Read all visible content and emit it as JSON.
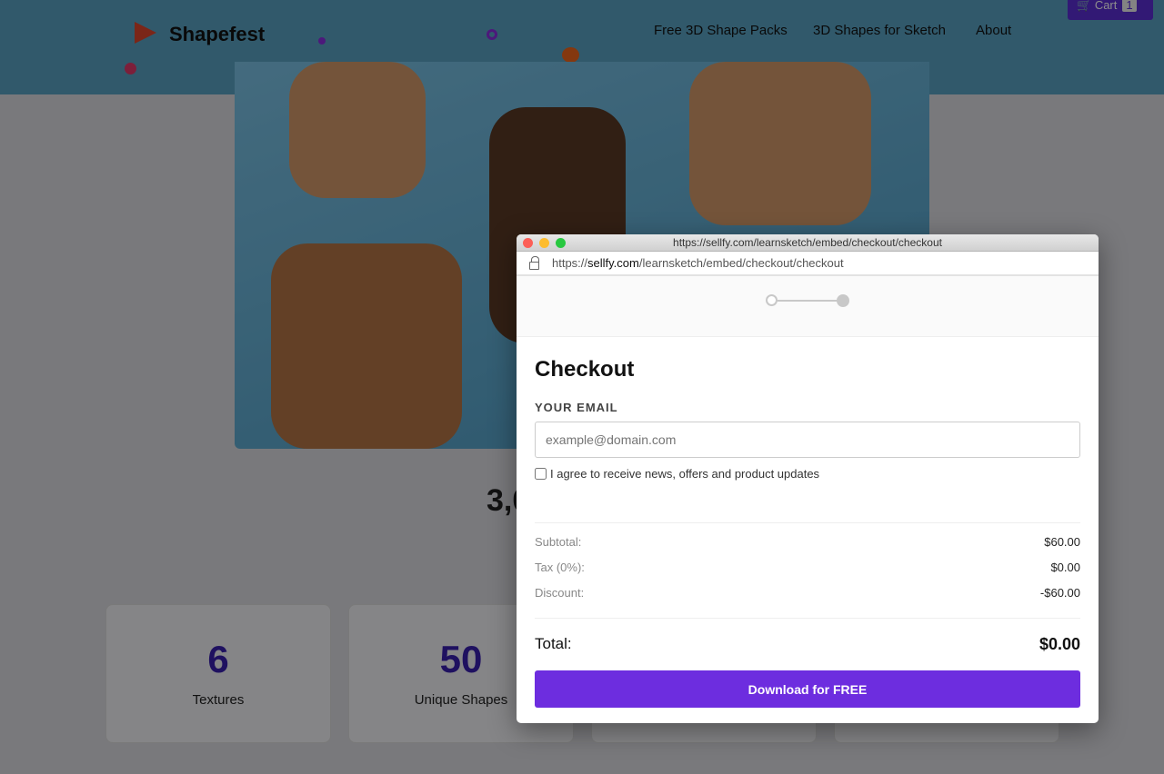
{
  "site": {
    "logo": "Shapefest",
    "nav": [
      "Free 3D Shape Packs",
      "3D Shapes for Sketch",
      "About"
    ],
    "cart_label": "Cart",
    "cart_count": "1"
  },
  "hero": {
    "headline_partial": "3,0"
  },
  "stats": [
    {
      "value": "6",
      "label": "Textures"
    },
    {
      "value": "50",
      "label": "Unique Shapes"
    },
    {
      "value": "",
      "label": ""
    },
    {
      "value": "",
      "label": ""
    }
  ],
  "popup": {
    "window_title": "https://sellfy.com/learnsketch/embed/checkout/checkout",
    "url_prefix": "https://",
    "url_domain": "sellfy.com",
    "url_path": "/learnsketch/embed/checkout/checkout",
    "steps_total": 2,
    "step_current": 1,
    "title": "Checkout",
    "email_label": "YOUR EMAIL",
    "email_placeholder": "example@domain.com",
    "email_value": "",
    "agree_label": "I agree to receive news, offers and product updates",
    "agree_checked": false,
    "summary": [
      {
        "k": "Subtotal:",
        "v": "$60.00"
      },
      {
        "k": "Tax (0%):",
        "v": "$0.00"
      },
      {
        "k": "Discount:",
        "v": "-$60.00"
      }
    ],
    "total_label": "Total:",
    "total_value": "$0.00",
    "button": "Download for FREE"
  },
  "colors": {
    "accent": "#6d2ddf",
    "brand": "#3a1fb0"
  }
}
